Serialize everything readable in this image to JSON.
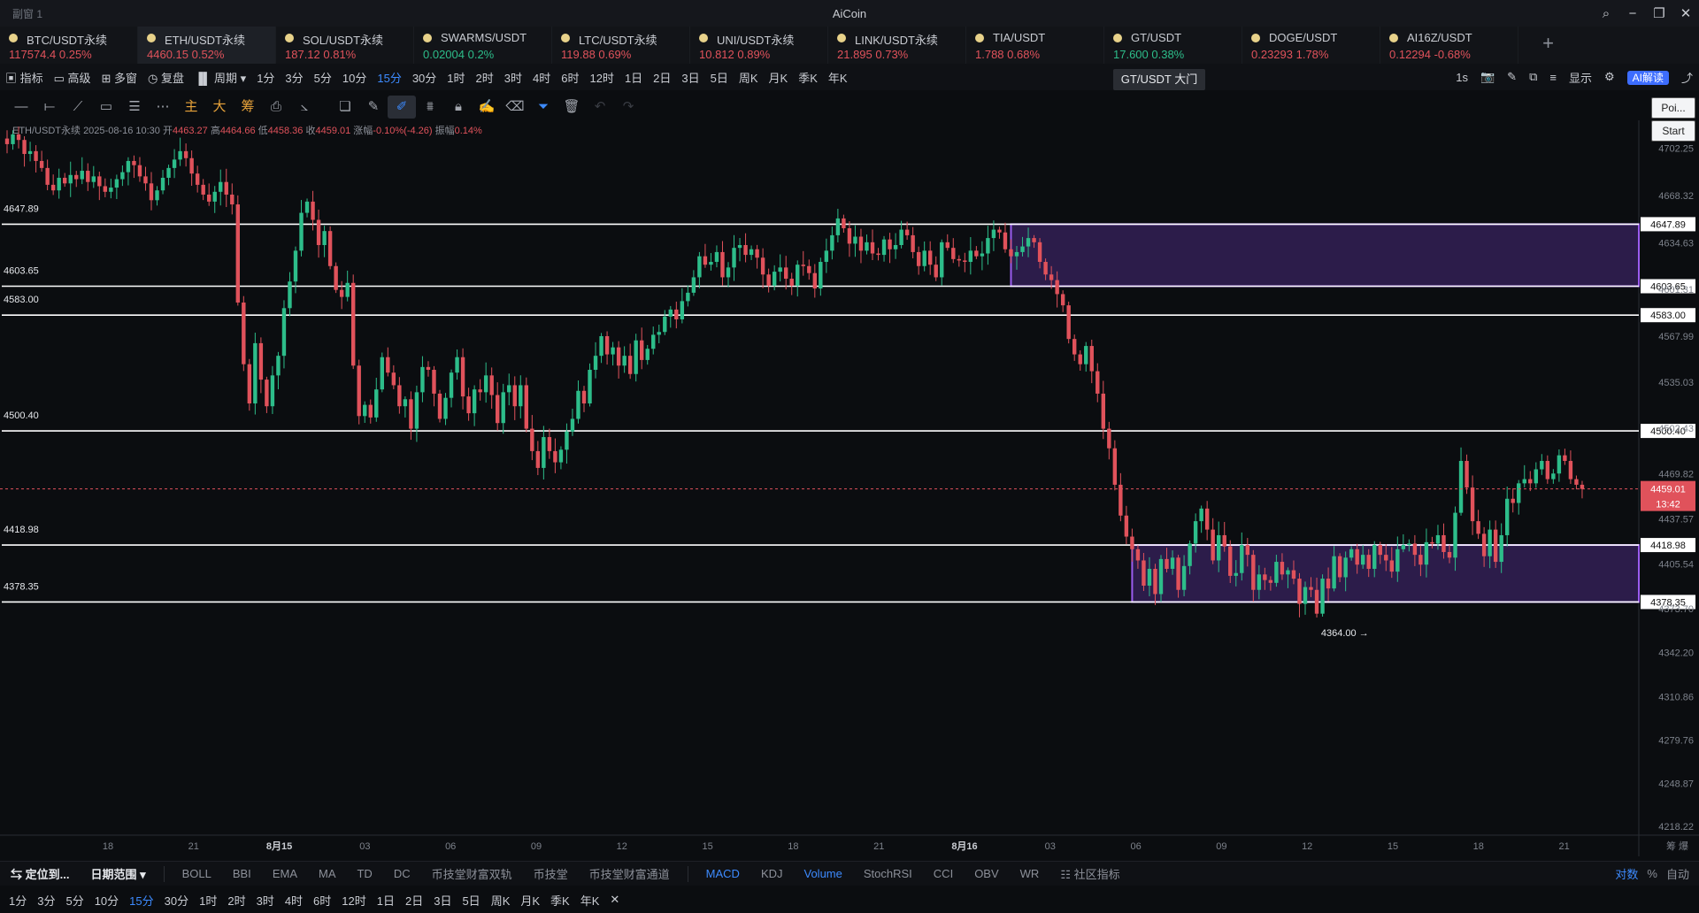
{
  "window": {
    "subtitle": "副窗 1",
    "title": "AiCoin"
  },
  "tabs": [
    {
      "name": "BTC/USDT永续",
      "price": "117574.4",
      "change": "0.25%",
      "dir": "up"
    },
    {
      "name": "ETH/USDT永续",
      "price": "4460.15",
      "change": "0.52%",
      "dir": "up"
    },
    {
      "name": "SOL/USDT永续",
      "price": "187.12",
      "change": "0.81%",
      "dir": "up"
    },
    {
      "name": "SWARMS/USDT",
      "price": "0.02004",
      "change": "0.2%",
      "dir": "down"
    },
    {
      "name": "LTC/USDT永续",
      "price": "119.88",
      "change": "0.69%",
      "dir": "up"
    },
    {
      "name": "UNI/USDT永续",
      "price": "10.812",
      "change": "0.89%",
      "dir": "up"
    },
    {
      "name": "LINK/USDT永续",
      "price": "21.895",
      "change": "0.73%",
      "dir": "up"
    },
    {
      "name": "TIA/USDT",
      "price": "1.788",
      "change": "0.68%",
      "dir": "up"
    },
    {
      "name": "GT/USDT",
      "price": "17.600",
      "change": "0.38%",
      "dir": "down"
    },
    {
      "name": "DOGE/USDT",
      "price": "0.23293",
      "change": "1.78%",
      "dir": "up"
    },
    {
      "name": "AI16Z/USDT",
      "price": "0.12294",
      "change": "-0.68%",
      "dir": "up"
    }
  ],
  "toolbar": {
    "items": [
      "指标",
      "高级",
      "多窗",
      "复盘",
      "周期"
    ],
    "timeframes": [
      "1分",
      "3分",
      "5分",
      "10分",
      "15分",
      "30分",
      "1时",
      "2时",
      "3时",
      "4时",
      "6时",
      "12时",
      "1日",
      "2日",
      "3日",
      "5日",
      "周K",
      "月K",
      "季K",
      "年K"
    ],
    "selected_timeframe": "15分",
    "tooltip": "GT/USDT 大门",
    "right": {
      "interval": "1s",
      "display": "显示",
      "ai": "AI解读"
    }
  },
  "tools2": {
    "main": "主",
    "large": "大",
    "chip": "筹"
  },
  "side_buttons": {
    "poi": "Poi...",
    "start": "Start"
  },
  "ohlc": {
    "symbol": "ETH/USDT永续",
    "time": "2025-08-16 10:30",
    "open_label": "开",
    "open": "4463.27",
    "high_label": "高",
    "high": "4464.66",
    "low_label": "低",
    "low": "4458.36",
    "close_label": "收",
    "close": "4459.01",
    "change_label": "涨幅",
    "change": "-0.10%(-4.26)",
    "amp_label": "振幅",
    "amp": "0.14%"
  },
  "chart_data": {
    "type": "candlestick",
    "y_ticks": [
      4702.25,
      4668.32,
      4634.63,
      4601.31,
      4567.99,
      4535.03,
      4502.43,
      4469.82,
      4437.57,
      4405.54,
      4373.7,
      4342.2,
      4310.86,
      4279.76,
      4248.87,
      4218.22
    ],
    "ylim": [
      4212,
      4722
    ],
    "x_labels": [
      "18",
      "21",
      "8月15",
      "03",
      "06",
      "09",
      "12",
      "15",
      "18",
      "21",
      "8月16",
      "03",
      "06",
      "09",
      "12",
      "15",
      "18",
      "21"
    ],
    "h_lines": [
      4647.89,
      4603.65,
      4583.0,
      4500.4,
      4418.98,
      4378.35
    ],
    "zones": [
      {
        "from_bar": 174,
        "top": 4647.89,
        "bottom": 4603.65,
        "color": "#7a3fd1"
      },
      {
        "from_bar": 195,
        "top": 4418.98,
        "bottom": 4378.35,
        "color": "#7a3fd1"
      }
    ],
    "current_price": "4459.01",
    "countdown": "13:42",
    "low_marker": "4364.00",
    "low_marker_bar": 236,
    "closes": [
      4705,
      4712,
      4708,
      4698,
      4700,
      4693,
      4688,
      4676,
      4672,
      4681,
      4677,
      4683,
      4680,
      4686,
      4678,
      4682,
      4675,
      4671,
      4674,
      4680,
      4685,
      4693,
      4690,
      4682,
      4677,
      4665,
      4672,
      4681,
      4688,
      4694,
      4700,
      4695,
      4684,
      4676,
      4669,
      4664,
      4671,
      4678,
      4669,
      4662,
      4592,
      4548,
      4520,
      4563,
      4537,
      4518,
      4540,
      4554,
      4588,
      4607,
      4629,
      4656,
      4664,
      4651,
      4633,
      4643,
      4618,
      4601,
      4596,
      4606,
      4547,
      4511,
      4519,
      4510,
      4530,
      4553,
      4542,
      4533,
      4518,
      4523,
      4502,
      4528,
      4546,
      4544,
      4527,
      4509,
      4524,
      4542,
      4553,
      4525,
      4513,
      4530,
      4528,
      4540,
      4526,
      4506,
      4528,
      4533,
      4518,
      4533,
      4502,
      4486,
      4474,
      4496,
      4486,
      4478,
      4487,
      4500,
      4509,
      4529,
      4520,
      4544,
      4554,
      4568,
      4555,
      4560,
      4547,
      4554,
      4541,
      4565,
      4551,
      4559,
      4569,
      4571,
      4582,
      4587,
      4580,
      4593,
      4599,
      4610,
      4625,
      4619,
      4621,
      4628,
      4610,
      4617,
      4631,
      4633,
      4626,
      4630,
      4624,
      4612,
      4604,
      4614,
      4617,
      4609,
      4604,
      4619,
      4618,
      4613,
      4602,
      4621,
      4629,
      4640,
      4652,
      4645,
      4634,
      4639,
      4629,
      4635,
      4627,
      4626,
      4637,
      4630,
      4633,
      4644,
      4640,
      4628,
      4618,
      4629,
      4619,
      4610,
      4635,
      4631,
      4623,
      4622,
      4621,
      4629,
      4625,
      4627,
      4638,
      4644,
      4642,
      4630,
      4625,
      4628,
      4632,
      4638,
      4635,
      4621,
      4612,
      4608,
      4598,
      4590,
      4566,
      4555,
      4548,
      4561,
      4543,
      4527,
      4502,
      4488,
      4462,
      4440,
      4425,
      4416,
      4408,
      4390,
      4402,
      4384,
      4409,
      4402,
      4410,
      4387,
      4404,
      4420,
      4436,
      4445,
      4430,
      4408,
      4426,
      4418,
      4397,
      4399,
      4419,
      4412,
      4387,
      4398,
      4394,
      4392,
      4407,
      4398,
      4401,
      4395,
      4377,
      4389,
      4387,
      4370,
      4395,
      4388,
      4411,
      4396,
      4410,
      4416,
      4405,
      4412,
      4402,
      4419,
      4412,
      4408,
      4400,
      4416,
      4419,
      4420,
      4412,
      4405,
      4421,
      4420,
      4426,
      4414,
      4410,
      4442,
      4479,
      4460,
      4436,
      4427,
      4411,
      4430,
      4407,
      4426,
      4452,
      4449,
      4463,
      4466,
      4463,
      4473,
      4479,
      4466,
      4470,
      4483,
      4479,
      4466,
      4462,
      4459
    ],
    "bar_spacing": 6.52,
    "plot_right": 1852
  },
  "bottom": {
    "locate": "定位到...",
    "range": "日期范围",
    "indicators_left": [
      "BOLL",
      "BBI",
      "EMA",
      "MA",
      "TD",
      "DC",
      "币技堂财富双轨",
      "币技堂",
      "币技堂财富通道"
    ],
    "indicators_right": [
      "MACD",
      "KDJ",
      "Volume",
      "StochRSI",
      "CCI",
      "OBV",
      "WR",
      "社区指标"
    ],
    "selected": [
      "MACD",
      "Volume"
    ],
    "right": [
      "对数",
      "%",
      "自动"
    ],
    "corner": "筹 爆"
  }
}
